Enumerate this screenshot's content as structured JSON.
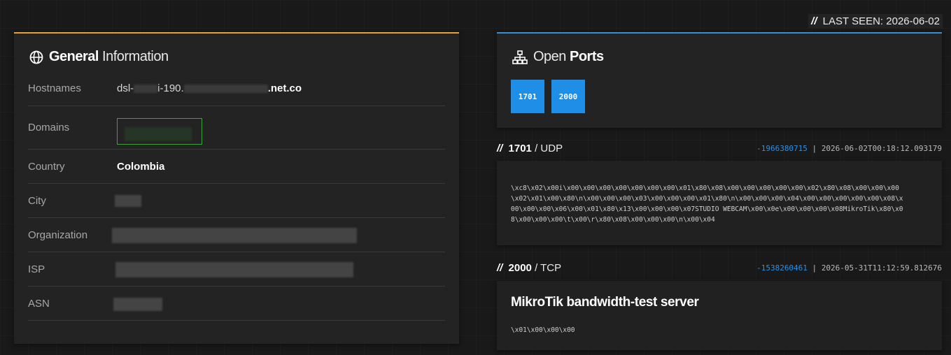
{
  "general": {
    "title_bold": "General",
    "title_light": "Information",
    "rows": {
      "hostnames": {
        "label": "Hostnames",
        "prefix": "dsl-",
        "mid": "i-190.",
        "suffix": ".net.co"
      },
      "domains": {
        "label": "Domains"
      },
      "country": {
        "label": "Country",
        "value": "Colombia"
      },
      "city": {
        "label": "City"
      },
      "organization": {
        "label": "Organization"
      },
      "isp": {
        "label": "ISP"
      },
      "asn": {
        "label": "ASN"
      }
    },
    "accent": "#e8a23b"
  },
  "last_seen": {
    "prefix": "//",
    "label": "LAST SEEN: 2026-06-02"
  },
  "ports": {
    "title_light": "Open",
    "title_bold": "Ports",
    "buttons": [
      "1701",
      "2000"
    ],
    "accent": "#3b8fd0",
    "button_color": "#1e8ee6"
  },
  "services": [
    {
      "port": "1701",
      "proto": "UDP",
      "hash": "-1966380715",
      "timestamp": "2026-06-02T00:18:12.093179",
      "banner_lines": [
        "\\xc8\\x02\\x00i\\x00\\x00\\x00\\x00\\x00\\x00\\x00\\x01\\x80\\x08\\x00\\x00\\x00\\x00\\x00\\x02\\x80\\x08\\x00\\x00\\x00",
        "\\x02\\x01\\x00\\x80\\n\\x00\\x00\\x00\\x03\\x00\\x00\\x00\\x01\\x80\\n\\x00\\x00\\x00\\x04\\x00\\x00\\x00\\x00\\x00\\x08\\x",
        "00\\x00\\x00\\x06\\x00\\x01\\x80\\x13\\x00\\x00\\x00\\x07STUDIO WEBCAM\\x00\\x0e\\x00\\x00\\x00\\x08MikroTik\\x80\\x0",
        "8\\x00\\x00\\x00\\t\\x00\\r\\x80\\x08\\x00\\x00\\x00\\n\\x00\\x04"
      ]
    },
    {
      "port": "2000",
      "proto": "TCP",
      "hash": "-1538260461",
      "timestamp": "2026-05-31T11:12:59.812676",
      "product": "MikroTik bandwidth-test server",
      "banner_lines": [
        "\\x01\\x00\\x00\\x00"
      ]
    }
  ]
}
